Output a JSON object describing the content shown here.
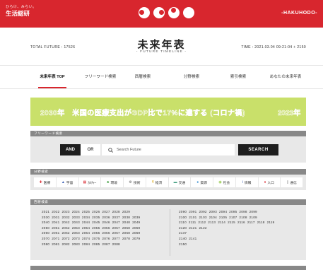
{
  "brand": {
    "sub": "ひらけ、みらい。",
    "name": "生活総研",
    "hakuhodo": "-HAKUHODO-"
  },
  "header": {
    "total": "TOTAL FUTURE : 17526",
    "title": "未来年表",
    "subtitle": "- FUTURE TIMELINE -",
    "time": "TIME : 2021.03.04 09:21:04 + 2150"
  },
  "nav": {
    "items": [
      {
        "label": "未来年表 TOP"
      },
      {
        "label": "フリーワード検索"
      },
      {
        "label": "西暦検索"
      },
      {
        "label": "分野検索"
      },
      {
        "label": "索引検索"
      },
      {
        "label": "あなたの未来年表"
      }
    ]
  },
  "banner": {
    "text": "2030年　米国の医療支出がGDP比で17%に達する (コロナ禍)",
    "year2": "2023年"
  },
  "search": {
    "heading": "フリーワード検索",
    "and_label": "AND",
    "or_label": "OR",
    "placeholder": "Search Future",
    "value": "",
    "button": "SEARCH"
  },
  "categories": {
    "heading": "分野検索",
    "items": [
      {
        "label": "医療",
        "icon": "✚",
        "color": "#d8262e"
      },
      {
        "label": "宇宙",
        "icon": "▲",
        "color": "#3a5fb5"
      },
      {
        "label": "ｶﾙﾁｬｰ",
        "icon": "▦",
        "color": "#d8262e"
      },
      {
        "label": "環境",
        "icon": "♣",
        "color": "#3a9a3a"
      },
      {
        "label": "技術",
        "icon": "⚙",
        "color": "#666666"
      },
      {
        "label": "経済",
        "icon": "¥",
        "color": "#d9a300"
      },
      {
        "label": "交通",
        "icon": "▬",
        "color": "#3a9a7a"
      },
      {
        "label": "資源",
        "icon": "●",
        "color": "#3a8fd0"
      },
      {
        "label": "社会",
        "icon": "◉",
        "color": "#8cc43c"
      },
      {
        "label": "情報",
        "icon": "i",
        "color": "#3a5fb5"
      },
      {
        "label": "人口",
        "icon": "♦",
        "color": "#d8262e"
      },
      {
        "label": "通信",
        "icon": "▯",
        "color": "#555555"
      }
    ]
  },
  "years": {
    "heading": "西暦検索",
    "left": "2021  2022  2023  2024  2025  2026  2027  2028  2029\n2030  2031  2032  2033  2034  2035  2036  2037  2038  2039\n2040  2041  2042  2043  2044  2045  2046  2047  2048  2049\n2050  2051  2052  2053  2054  2055  2056  2057  2058  2059\n2060  2061  2062  2063  2064  2065  2066  2067  2068  2069\n2070  2071  2072  2073  2074  2075  2076  2077  2078  2079\n2080  2081  2082  2083  2084  2085  2087  2088",
    "right": "2090  2091  2092  2093  2094  2095  2098  2099\n2100  2101  2103  2104  2105  2107  2108  2109\n2110  2111  2112  2113  2114  2115  2116  2117  2118  2119\n2120  2121  2122\n2137\n2140  2141\n2150"
  }
}
